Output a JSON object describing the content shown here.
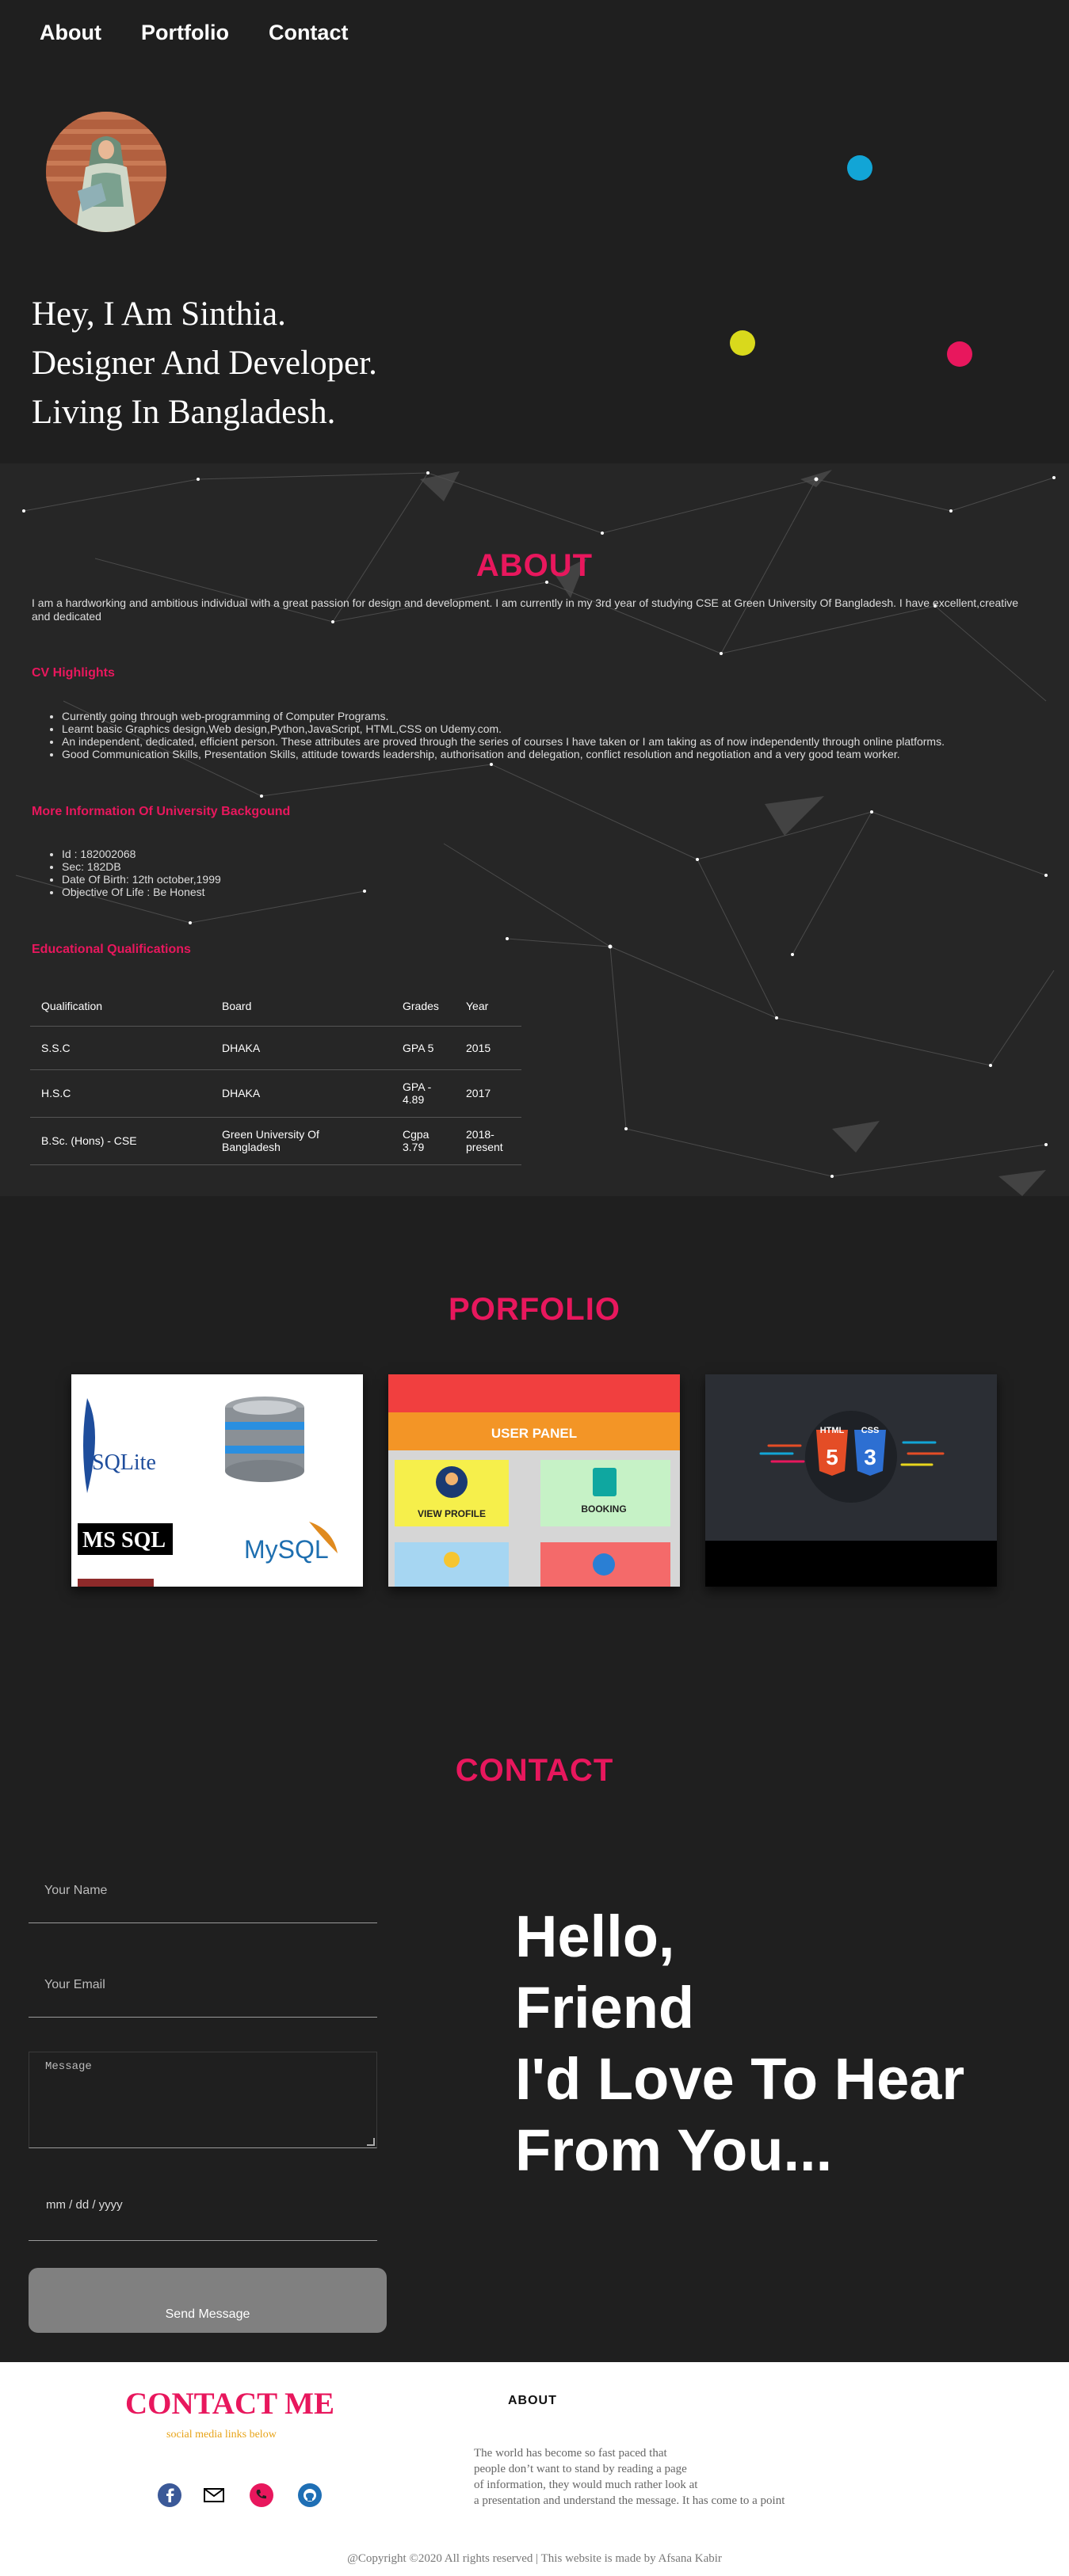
{
  "nav": {
    "items": [
      "About",
      "Portfolio",
      "Contact"
    ]
  },
  "hero": {
    "lines": [
      "Hey, I Am Sinthia.",
      "Designer And Developer.",
      "Living In Bangladesh."
    ]
  },
  "colors": {
    "accent": "#e8175d",
    "dot_blue": "#12a5d6",
    "dot_yellow": "#d9d91c",
    "dot_pink": "#e8175d",
    "background": "#1f1f1f"
  },
  "about": {
    "title": "ABOUT",
    "paragraph": "I am a hardworking and ambitious individual with a great passion for design and development. I am currently in my 3rd year of studying CSE at Green University Of Bangladesh. I have excellent,creative and dedicated",
    "cv_heading": "CV Highlights",
    "cv_items": [
      "Currently going through web-programming of Computer Programs.",
      "Learnt basic Graphics design,Web design,Python,JavaScript, HTML,CSS on Udemy.com.",
      "An independent, dedicated, efficient person. These attributes are proved through the series of courses I have taken or I am taking as of now independently through online platforms.",
      "Good Communication Skills, Presentation Skills, attitude towards leadership, authorisation and delegation, conflict resolution and negotiation and a very good team worker."
    ],
    "uni_heading": "More Information Of University Backgound",
    "uni_items": [
      "Id : 182002068",
      "Sec: 182DB",
      "Date Of Birth: 12th october,1999",
      "Objective Of Life : Be Honest"
    ],
    "edu_heading": "Educational Qualifications",
    "edu_table": {
      "headers": [
        "Qualification",
        "Board",
        "Grades",
        "Year"
      ],
      "rows": [
        [
          "S.S.C",
          "DHAKA",
          "GPA 5",
          "2015"
        ],
        [
          "H.S.C",
          "DHAKA",
          "GPA - 4.89",
          "2017"
        ],
        [
          "B.Sc. (Hons) - CSE",
          "Green University Of Bangladesh",
          "Cgpa 3.79",
          "2018-present"
        ]
      ]
    }
  },
  "portfolio": {
    "title": "PORFOLIO",
    "card1": {
      "sqlite": "SQLite",
      "mssql": "MS SQL",
      "mysql": "MySQL"
    },
    "card2": {
      "header": "USER PANEL",
      "tile1": "VIEW PROFILE",
      "tile2": "BOOKING"
    },
    "card3": {
      "html": "HTML",
      "css": "CSS",
      "html_num": "5",
      "css_num": "3"
    }
  },
  "contact": {
    "title": "CONTACT",
    "name_placeholder": "Your Name",
    "email_placeholder": "Your Email",
    "message_placeholder": "Message",
    "date_placeholder": "mm / dd / yyyy",
    "send_label": "Send Message",
    "hello_lines": [
      "Hello,",
      "Friend",
      "I'd Love To Hear",
      "From You..."
    ]
  },
  "footer": {
    "title": "CONTACT ME",
    "subtitle": "social media links below",
    "about_heading": "ABOUT",
    "about_lines": [
      "The world has become so fast paced that",
      "people don’t want to stand by reading a page",
      "of information, they would much rather look at",
      "a presentation and understand the message. It has come to a point"
    ],
    "social_icons": [
      "facebook-icon",
      "mail-icon",
      "phone-icon",
      "github-icon"
    ],
    "copyright": "@Copyright ©2020 All rights reserved | This website is made by Afsana Kabir"
  }
}
